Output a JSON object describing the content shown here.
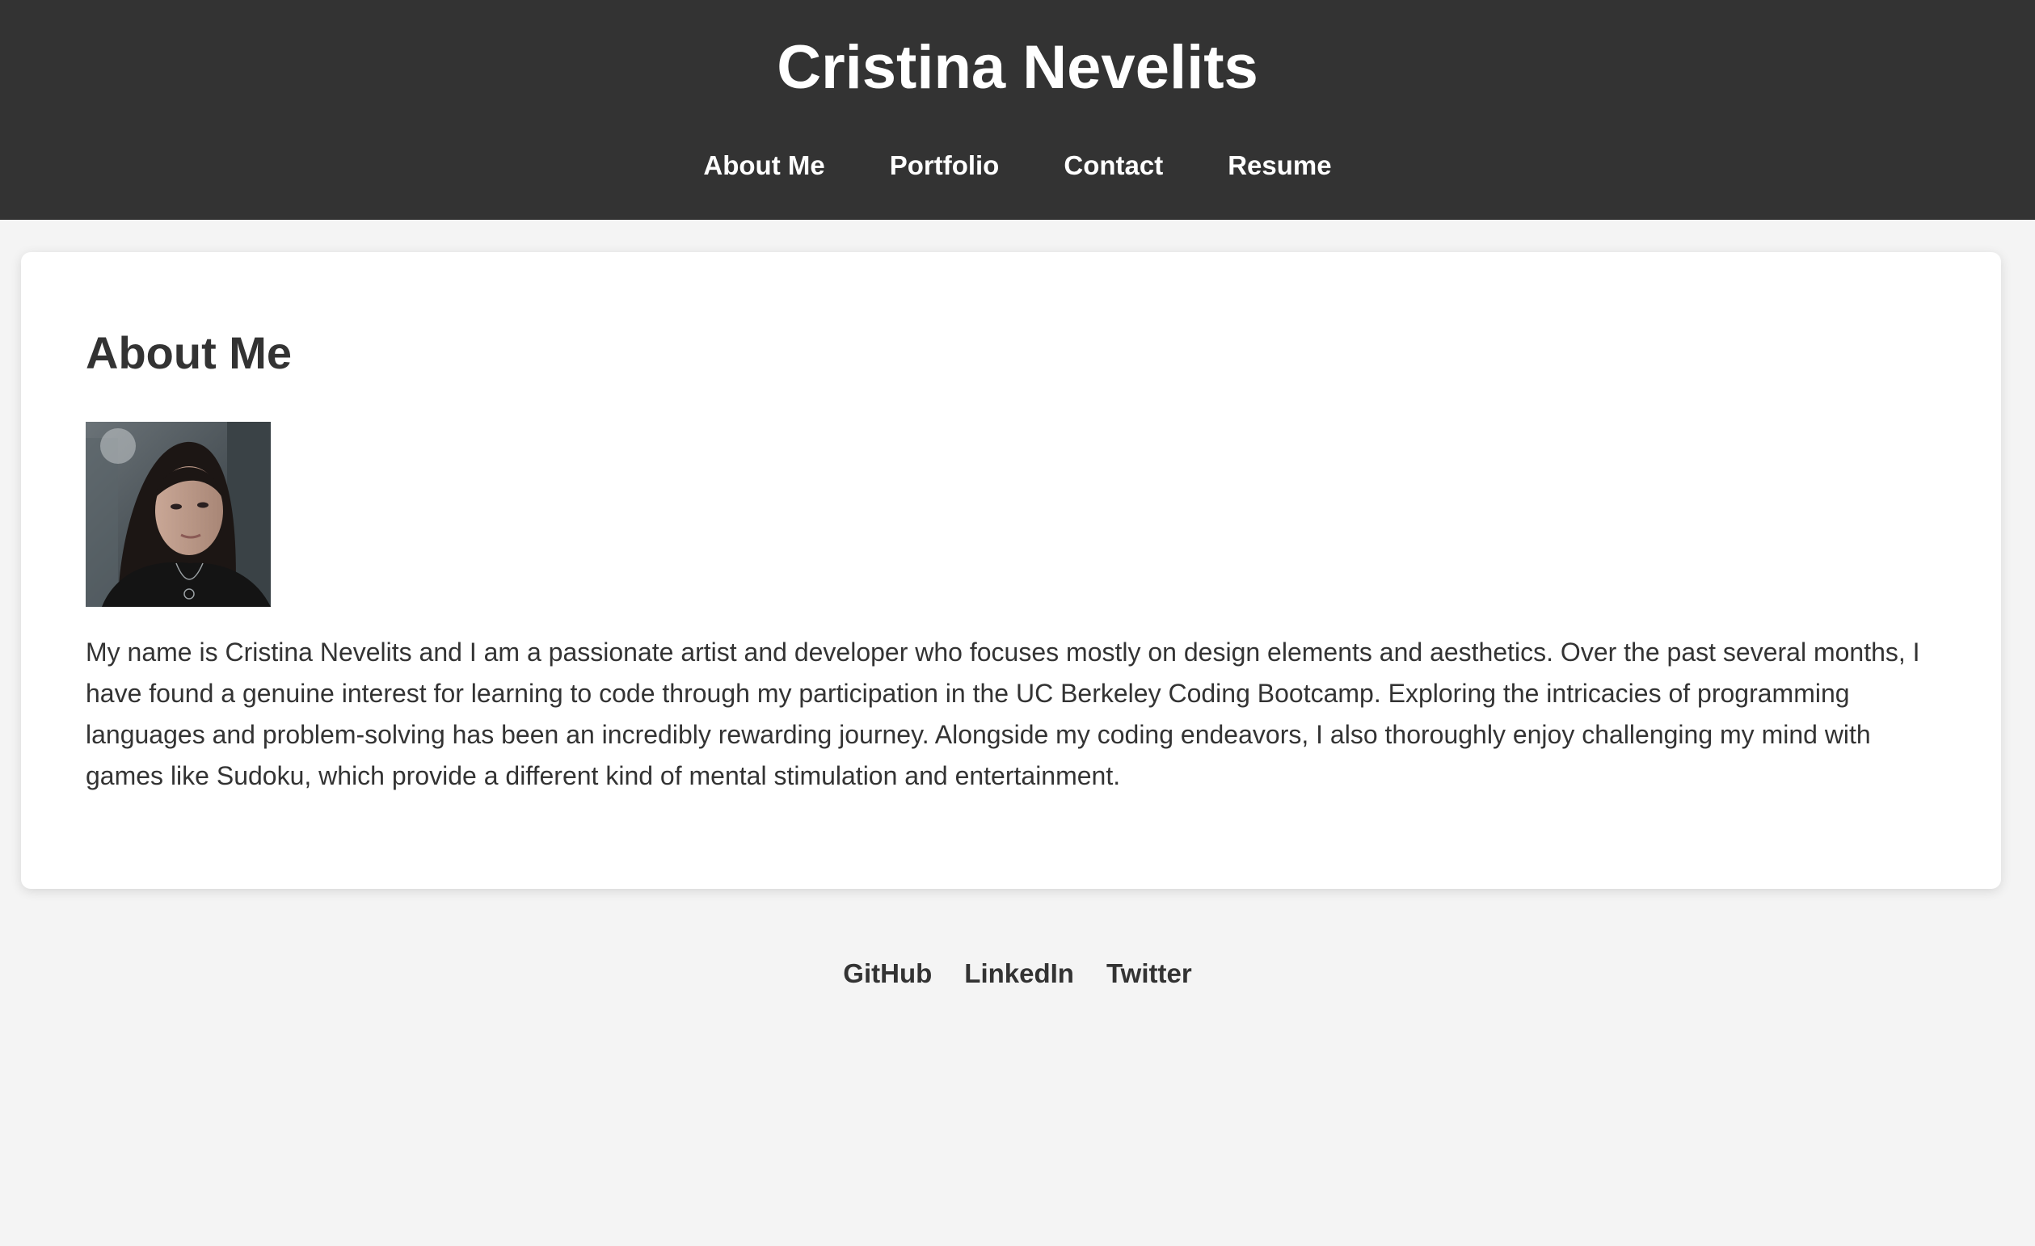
{
  "header": {
    "title": "Cristina Nevelits",
    "nav": [
      {
        "label": "About Me"
      },
      {
        "label": "Portfolio"
      },
      {
        "label": "Contact"
      },
      {
        "label": "Resume"
      }
    ]
  },
  "about": {
    "heading": "About Me",
    "bio": "My name is Cristina Nevelits and I am a passionate artist and developer who focuses mostly on design elements and aesthetics. Over the past several months, I have found a genuine interest for learning to code through my participation in the UC Berkeley Coding Bootcamp. Exploring the intricacies of programming languages and problem-solving has been an incredibly rewarding journey. Alongside my coding endeavors, I also thoroughly enjoy challenging my mind with games like Sudoku, which provide a different kind of mental stimulation and entertainment."
  },
  "footer": {
    "links": [
      {
        "label": "GitHub"
      },
      {
        "label": "LinkedIn"
      },
      {
        "label": "Twitter"
      }
    ]
  },
  "colors": {
    "header_bg": "#333333",
    "page_bg": "#f4f4f4",
    "card_bg": "#ffffff",
    "text": "#333333"
  }
}
